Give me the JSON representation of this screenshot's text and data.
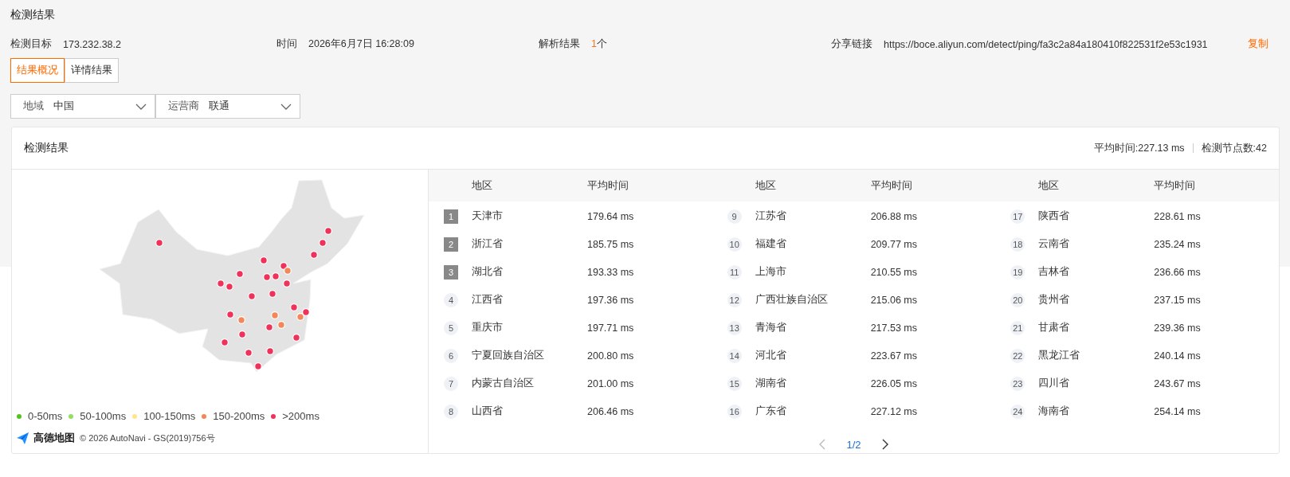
{
  "page_title": "检测结果",
  "info": [
    {
      "label": "检测目标",
      "value": "173.232.38.2"
    },
    {
      "label": "时间",
      "value": "2026年6月7日 16:28:09"
    },
    {
      "label": "解析结果",
      "count": "1",
      "unit": "个"
    },
    {
      "label": "分享链接",
      "value": "https://boce.aliyun.com/detect/ping/fa3c2a84a180410f822531f2e53c1931",
      "action": "复制"
    }
  ],
  "tabs": [
    {
      "label": "结果概况",
      "selected": true
    },
    {
      "label": "详情结果",
      "selected": false
    }
  ],
  "filters": [
    {
      "label": "地域",
      "value": "中国"
    },
    {
      "label": "运营商",
      "value": "联通"
    }
  ],
  "card": {
    "title": "检测结果",
    "summary": [
      "平均时间:227.13 ms",
      "检测节点数:42"
    ],
    "legend": [
      {
        "label": "0-50ms",
        "color": "#52c41a"
      },
      {
        "label": "50-100ms",
        "color": "#95de64"
      },
      {
        "label": "100-150ms",
        "color": "#ffe58f"
      },
      {
        "label": "150-200ms",
        "color": "#f4875a"
      },
      {
        "label": ">200ms",
        "color": "#f0325a"
      }
    ],
    "attribution": {
      "brand": "高德地图",
      "text": "© 2026 AutoNavi - GS(2019)756号"
    },
    "table": {
      "columns": [
        "地区",
        "平均时间",
        "地区",
        "平均时间",
        "地区",
        "平均时间"
      ],
      "rows": [
        {
          "rank": "1",
          "kind": "top",
          "region": "天津市",
          "time": "179.64 ms"
        },
        {
          "rank": "2",
          "kind": "top",
          "region": "浙江省",
          "time": "185.75 ms"
        },
        {
          "rank": "3",
          "kind": "top",
          "region": "湖北省",
          "time": "193.33 ms"
        },
        {
          "rank": "4",
          "kind": "normal",
          "region": "江西省",
          "time": "197.36 ms"
        },
        {
          "rank": "5",
          "kind": "normal",
          "region": "重庆市",
          "time": "197.71 ms"
        },
        {
          "rank": "6",
          "kind": "normal",
          "region": "宁夏回族自治区",
          "time": "200.80 ms"
        },
        {
          "rank": "7",
          "kind": "normal",
          "region": "内蒙古自治区",
          "time": "201.00 ms"
        },
        {
          "rank": "8",
          "kind": "normal",
          "region": "山西省",
          "time": "206.46 ms"
        },
        {
          "rank": "9",
          "kind": "normal",
          "region": "江苏省",
          "time": "206.88 ms"
        },
        {
          "rank": "10",
          "kind": "normal",
          "region": "福建省",
          "time": "209.77 ms"
        },
        {
          "rank": "11",
          "kind": "normal",
          "region": "上海市",
          "time": "210.55 ms"
        },
        {
          "rank": "12",
          "kind": "normal",
          "region": "广西壮族自治区",
          "time": "215.06 ms"
        },
        {
          "rank": "13",
          "kind": "normal",
          "region": "青海省",
          "time": "217.53 ms"
        },
        {
          "rank": "14",
          "kind": "normal",
          "region": "河北省",
          "time": "223.67 ms"
        },
        {
          "rank": "15",
          "kind": "normal",
          "region": "湖南省",
          "time": "226.05 ms"
        },
        {
          "rank": "16",
          "kind": "normal",
          "region": "广东省",
          "time": "227.12 ms"
        },
        {
          "rank": "17",
          "kind": "normal",
          "region": "陕西省",
          "time": "228.61 ms"
        },
        {
          "rank": "18",
          "kind": "normal",
          "region": "云南省",
          "time": "235.24 ms"
        },
        {
          "rank": "19",
          "kind": "normal",
          "region": "吉林省",
          "time": "236.66 ms"
        },
        {
          "rank": "20",
          "kind": "normal",
          "region": "贵州省",
          "time": "237.15 ms"
        },
        {
          "rank": "21",
          "kind": "normal",
          "region": "甘肃省",
          "time": "239.36 ms"
        },
        {
          "rank": "22",
          "kind": "normal",
          "region": "黑龙江省",
          "time": "240.14 ms"
        },
        {
          "rank": "23",
          "kind": "normal",
          "region": "四川省",
          "time": "243.67 ms"
        },
        {
          "rank": "24",
          "kind": "normal",
          "region": "海南省",
          "time": "254.14 ms"
        }
      ]
    },
    "pager": {
      "page": "1/2",
      "prev": {
        "disabled": true
      },
      "next": {
        "disabled": false
      }
    }
  }
}
